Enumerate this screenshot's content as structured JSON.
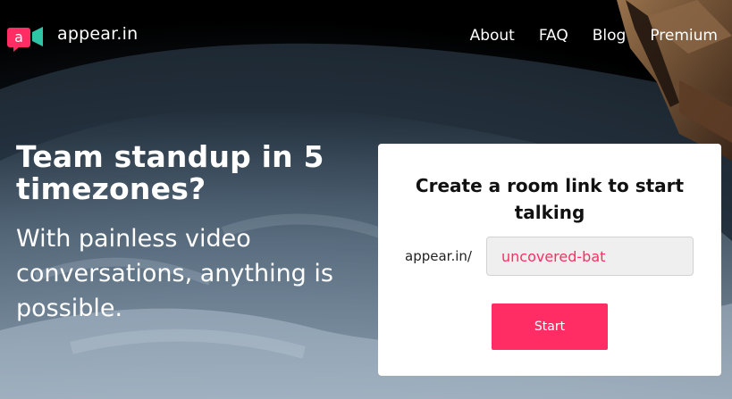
{
  "brand": {
    "name": "appear.in",
    "accent": "#ff2d63",
    "logo_secondary": "#2ec4a6"
  },
  "nav": {
    "items": [
      {
        "label": "About"
      },
      {
        "label": "FAQ"
      },
      {
        "label": "Blog"
      },
      {
        "label": "Premium"
      }
    ]
  },
  "hero": {
    "title": "Team standup in 5 timezones?",
    "subtitle": "With painless video conversations, anything is possible."
  },
  "room_card": {
    "title": "Create a room link to start talking",
    "prefix": "appear.in/",
    "input_value": "uncovered-bat",
    "start_label": "Start"
  }
}
